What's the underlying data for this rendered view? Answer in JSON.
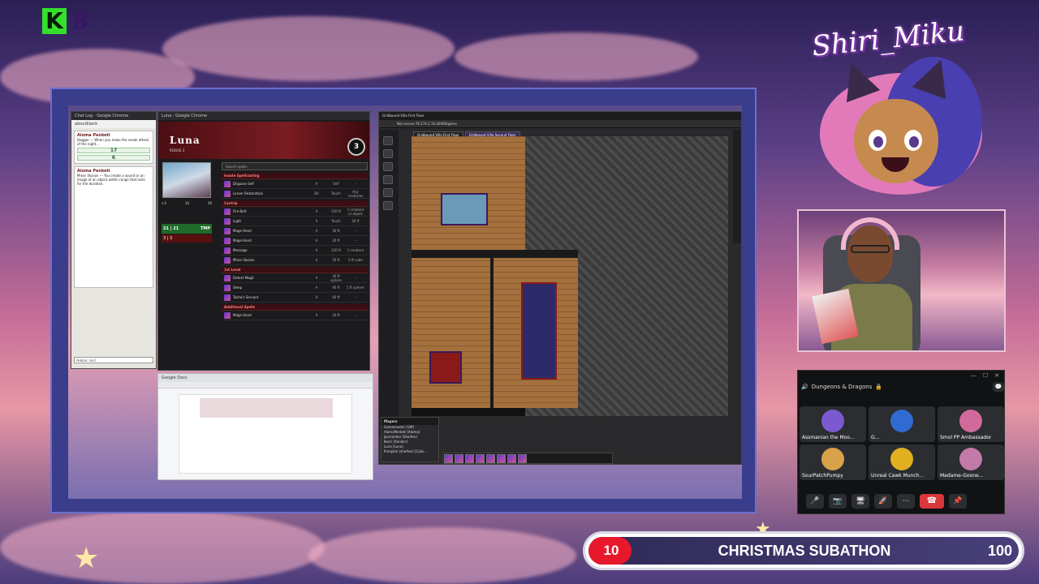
{
  "overlay": {
    "counter_value": "8",
    "brand_name": "Shiri_Miku"
  },
  "chat": {
    "title": "Chat Log - Google Chrome",
    "user": "aboutblank",
    "cards": [
      {
        "name": "Aloma Penketi",
        "text": "Dagger — When you make the sneak attack of the night...",
        "roll_label": "17",
        "roll_sub": "6"
      },
      {
        "name": "Aloma Penketi",
        "text": "Minor Illusion — You create a sound or an image of an object within range that lasts for the duration."
      }
    ],
    "input_placeholder": "Pebble: Hall"
  },
  "sheet": {
    "title": "Luna - Google Chrome",
    "character_name": "Luna",
    "character_class": "ROGUE 3",
    "level": "3",
    "armor_class": "14",
    "speed": "30",
    "initiative": "+3",
    "hp": "21 | 21",
    "hp_label": "TMP",
    "hp_max": "3 | 3",
    "search_placeholder": "Search spells",
    "col_time": "TIME",
    "col_range": "RANGE",
    "col_target": "TARGET",
    "col_roll": "ROLL",
    "sections": [
      {
        "title": "Innate Spellcasting",
        "spells": [
          {
            "name": "Disguise Self",
            "time": "A",
            "range": "Self",
            "target": "–"
          },
          {
            "name": "Lesser Restoration",
            "time": "BA",
            "range": "Touch",
            "target": "Any creatures"
          }
        ]
      },
      {
        "title": "Cantrip",
        "spells": [
          {
            "name": "Fire Bolt",
            "time": "A",
            "range": "120 ft",
            "target": "1 creature or object"
          },
          {
            "name": "Light",
            "time": "A",
            "range": "Touch",
            "target": "20 ft"
          },
          {
            "name": "Mage Hand",
            "time": "A",
            "range": "30 ft",
            "target": "–"
          },
          {
            "name": "Mage Hand",
            "time": "A",
            "range": "30 ft",
            "target": "–"
          },
          {
            "name": "Message",
            "time": "A",
            "range": "120 ft",
            "target": "1 creature"
          },
          {
            "name": "Minor Illusion",
            "time": "A",
            "range": "30 ft",
            "target": "5 ft cube"
          }
        ]
      },
      {
        "title": "1st Level",
        "spells": [
          {
            "name": "Detect Magic",
            "time": "A",
            "range": "30 ft sphere",
            "target": "–"
          },
          {
            "name": "Sleep",
            "time": "A",
            "range": "90 ft",
            "target": "5 ft sphere"
          },
          {
            "name": "Tasha's Servant",
            "time": "A",
            "range": "60 ft",
            "target": "–"
          }
        ]
      },
      {
        "title": "Additional Spells",
        "spells": [
          {
            "name": "Mage Hand",
            "time": "A",
            "range": "30 ft",
            "target": "–"
          }
        ]
      }
    ]
  },
  "doc": {
    "title": "Google Docs"
  },
  "vtt": {
    "tab_title": "Gridbound Villa First Floor",
    "address": "Not secure   76.174.2.16:30000/game",
    "floor_tabs": [
      "Gridbound Villa First Floor",
      "Gridbound Villa Second Floor"
    ],
    "players_title": "Players",
    "players": [
      "Gamemaster [GM]",
      "AlomaPenketi [Aloma]",
      "Jasmantan (She/her)",
      "Kenri [Xander]",
      "Luna [Luna]",
      "Pumpkin (she/her) [Calis..."
    ]
  },
  "discord": {
    "channel": "Dungeons & Dragons",
    "participants": [
      {
        "name": "Assmanian the Moo...",
        "color": "#7b5ad1"
      },
      {
        "name": "G...",
        "color": "#2f6bd1"
      },
      {
        "name": "Smol PP Ambassador",
        "color": "#d16a9a"
      },
      {
        "name": "SourPatchPumpy",
        "color": "#d8a24a"
      },
      {
        "name": "Unreal Cawk Munch...",
        "color": "#e0b020"
      },
      {
        "name": "Madame-Goone...",
        "color": "#c27aa8"
      }
    ]
  },
  "subathon": {
    "title": "CHRISTMAS SUBATHON",
    "start_value": "10",
    "end_value": "100",
    "progress_fraction": 0.1
  },
  "colors": {
    "accent_red": "#e8182c",
    "discord_end_call": "#da373c",
    "vtt_floor": "#a3703e"
  }
}
